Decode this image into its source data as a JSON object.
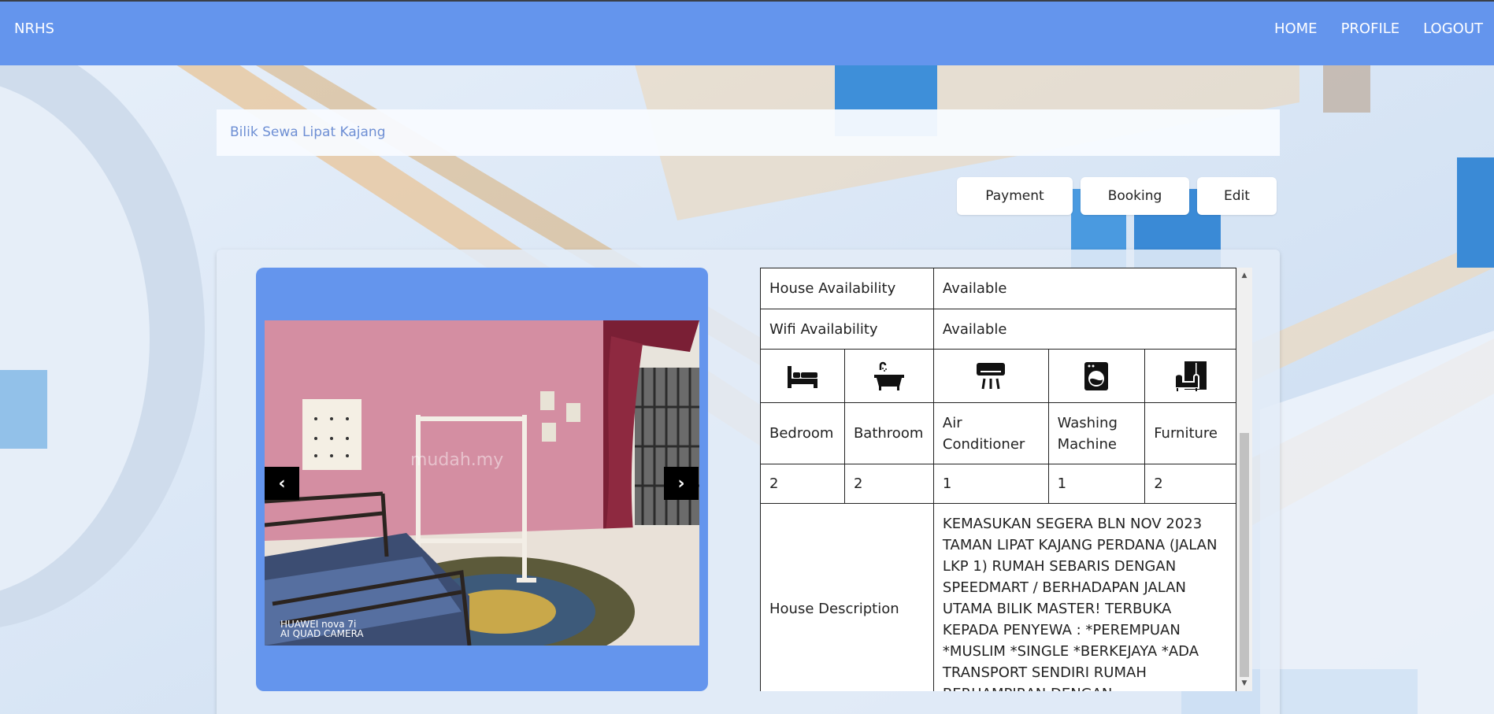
{
  "navbar": {
    "brand": "NRHS",
    "links": [
      "HOME",
      "PROFILE",
      "LOGOUT"
    ]
  },
  "house": {
    "title": "Bilik Sewa Lipat Kajang"
  },
  "actions": {
    "payment_label": "Payment",
    "booking_label": "Booking",
    "edit_label": "Edit"
  },
  "carousel": {
    "prev_label": "‹",
    "next_label": "›",
    "watermark": "mudah.my",
    "camera_tag_line1": "HUAWEI nova 7i",
    "camera_tag_line2": "AI QUAD CAMERA"
  },
  "details": {
    "house_availability_label": "House Availability",
    "house_availability_value": "Available",
    "wifi_availability_label": "Wifi Availability",
    "wifi_availability_value": "Available",
    "amenities": [
      {
        "icon": "bed-icon",
        "label": "Bedroom",
        "count": "2"
      },
      {
        "icon": "bathtub-icon",
        "label": "Bathroom",
        "count": "2"
      },
      {
        "icon": "air-conditioner-icon",
        "label": "Air Conditioner",
        "count": "1"
      },
      {
        "icon": "washing-machine-icon",
        "label": "Washing Machine",
        "count": "1"
      },
      {
        "icon": "furniture-icon",
        "label": "Furniture",
        "count": "2"
      }
    ],
    "description_label": "House Description",
    "description_value": "KEMASUKAN SEGERA BLN NOV 2023 TAMAN LIPAT KAJANG PERDANA (JALAN LKP 1) RUMAH SEBARIS DENGAN SPEEDMART / BERHADAPAN JALAN UTAMA BILIK MASTER! TERBUKA KEPADA PENYEWA : *PEREMPUAN *MUSLIM *SINGLE *BERKEJAYA *ADA TRANSPORT SENDIRI RUMAH BERHAMPIRAN DENGAN"
  },
  "colors": {
    "navbar_bg": "#6495ed",
    "title_text": "#6e8fd4",
    "carousel_bg": "#6495ed"
  }
}
